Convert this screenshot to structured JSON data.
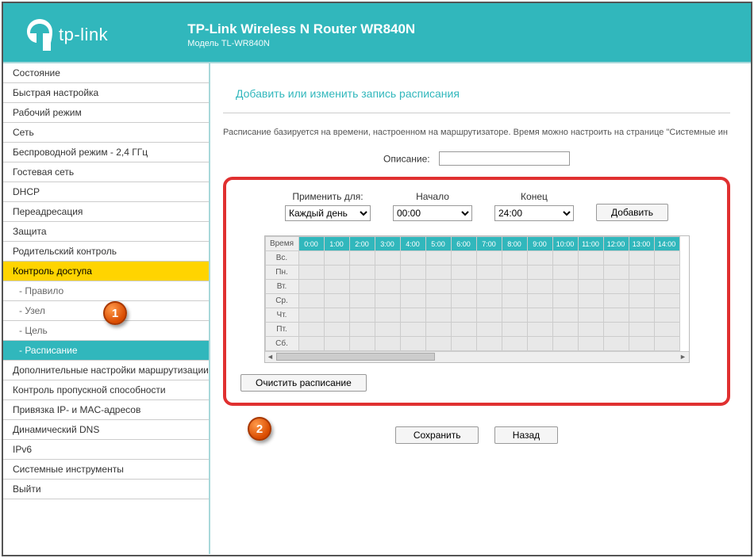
{
  "header": {
    "logo_text": "tp-link",
    "title": "TP-Link Wireless N Router WR840N",
    "subtitle": "Модель TL-WR840N"
  },
  "sidebar": {
    "items": [
      {
        "label": "Состояние",
        "type": "top"
      },
      {
        "label": "Быстрая настройка",
        "type": "top"
      },
      {
        "label": "Рабочий режим",
        "type": "top"
      },
      {
        "label": "Сеть",
        "type": "top"
      },
      {
        "label": "Беспроводной режим - 2,4 ГГц",
        "type": "top"
      },
      {
        "label": "Гостевая сеть",
        "type": "top"
      },
      {
        "label": "DHCP",
        "type": "top"
      },
      {
        "label": "Переадресация",
        "type": "top"
      },
      {
        "label": "Защита",
        "type": "top"
      },
      {
        "label": "Родительский контроль",
        "type": "top"
      },
      {
        "label": "Контроль доступа",
        "type": "top",
        "selected": true
      },
      {
        "label": "- Правило",
        "type": "sub"
      },
      {
        "label": "- Узел",
        "type": "sub"
      },
      {
        "label": "- Цель",
        "type": "sub"
      },
      {
        "label": "- Расписание",
        "type": "sub",
        "selected": true
      },
      {
        "label": "Дополнительные настройки маршрутизации",
        "type": "top"
      },
      {
        "label": "Контроль пропускной способности",
        "type": "top"
      },
      {
        "label": "Привязка IP- и MAC-адресов",
        "type": "top"
      },
      {
        "label": "Динамический DNS",
        "type": "top"
      },
      {
        "label": "IPv6",
        "type": "top"
      },
      {
        "label": "Системные инструменты",
        "type": "top"
      },
      {
        "label": "Выйти",
        "type": "top"
      }
    ]
  },
  "page": {
    "title": "Добавить или изменить запись расписания",
    "info": "Расписание базируется на времени, настроенном на маршрутизаторе. Время можно настроить на странице \"Системные ин",
    "desc_label": "Описание:",
    "desc_value": "",
    "apply_label": "Применить для:",
    "apply_value": "Каждый день",
    "start_label": "Начало",
    "start_value": "00:00",
    "end_label": "Конец",
    "end_value": "24:00",
    "add_btn": "Добавить",
    "time_header": "Время",
    "hours": [
      "0:00",
      "1:00",
      "2:00",
      "3:00",
      "4:00",
      "5:00",
      "6:00",
      "7:00",
      "8:00",
      "9:00",
      "10:00",
      "11:00",
      "12:00",
      "13:00",
      "14:00"
    ],
    "days": [
      "Вс.",
      "Пн.",
      "Вт.",
      "Ср.",
      "Чт.",
      "Пт.",
      "Сб."
    ],
    "clear_btn": "Очистить расписание",
    "save_btn": "Сохранить",
    "back_btn": "Назад"
  },
  "markers": {
    "m1": "1",
    "m2": "2"
  }
}
